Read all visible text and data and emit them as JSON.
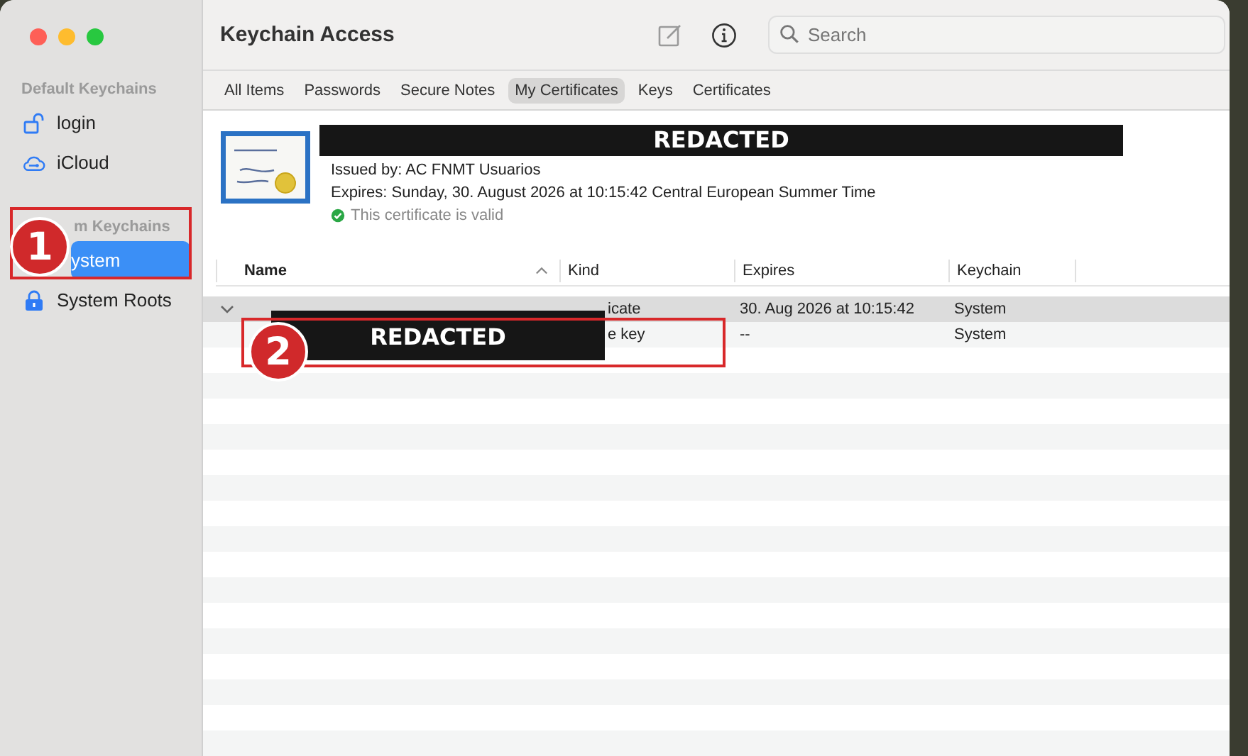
{
  "window": {
    "title": "Keychain Access"
  },
  "search": {
    "placeholder": "Search"
  },
  "sidebar": {
    "sections": [
      {
        "heading": "Default Keychains",
        "items": [
          {
            "label": "login",
            "kind": "unlocked",
            "selected": false
          },
          {
            "label": "iCloud",
            "kind": "cloud",
            "selected": false
          }
        ]
      },
      {
        "heading": "m Keychains",
        "items": [
          {
            "label": "ystem",
            "kind": "hidden",
            "selected": true
          },
          {
            "label": "System Roots",
            "kind": "locked",
            "selected": false
          }
        ]
      }
    ]
  },
  "tabs": [
    {
      "label": "All Items",
      "selected": false
    },
    {
      "label": "Passwords",
      "selected": false
    },
    {
      "label": "Secure Notes",
      "selected": false
    },
    {
      "label": "My Certificates",
      "selected": true
    },
    {
      "label": "Keys",
      "selected": false
    },
    {
      "label": "Certificates",
      "selected": false
    }
  ],
  "certificate": {
    "issued_by": "Issued by: AC FNMT Usuarios",
    "expires": "Expires: Sunday, 30. August 2026 at 10:15:42 Central European Summer Time",
    "status": "This certificate is valid",
    "valid": true
  },
  "table": {
    "columns": [
      {
        "label": "Name",
        "sorted": true
      },
      {
        "label": "Kind",
        "sorted": false
      },
      {
        "label": "Expires",
        "sorted": false
      },
      {
        "label": "Keychain",
        "sorted": false
      }
    ],
    "rows": [
      {
        "kind_text": "icate",
        "expires": "30. Aug 2026 at 10:15:42",
        "keychain": "System",
        "selected": true,
        "expanded": true
      },
      {
        "kind_text": "e key",
        "expires": "--",
        "keychain": "System",
        "selected": false
      }
    ]
  },
  "redactions": [
    {
      "label": "REDACTED"
    },
    {
      "label": "REDACTED"
    }
  ],
  "annotations": [
    {
      "number": "1"
    },
    {
      "number": "2"
    }
  ]
}
